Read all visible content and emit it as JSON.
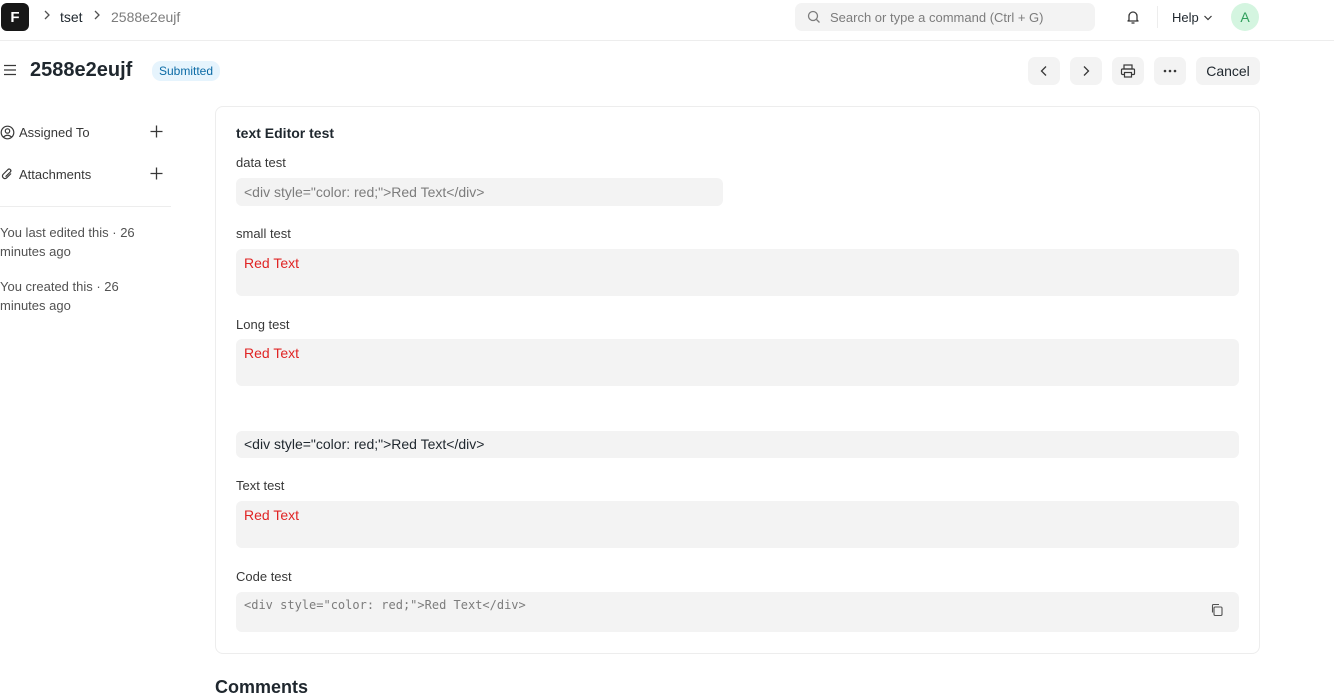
{
  "navbar": {
    "logo_letter": "F",
    "breadcrumbs": [
      "tset",
      "2588e2eujf"
    ],
    "search_placeholder": "Search or type a command (Ctrl + G)",
    "help_label": "Help",
    "avatar_initial": "A"
  },
  "header": {
    "title": "2588e2eujf",
    "status": "Submitted",
    "cancel_label": "Cancel"
  },
  "sidebar": {
    "assigned_label": "Assigned To",
    "attachments_label": "Attachments",
    "last_edited": "You last edited this · 26 minutes ago",
    "created": "You created this · 26 minutes ago"
  },
  "form": {
    "section_title": "text Editor test",
    "fields": [
      {
        "label": "data test",
        "value": "<div style=\"color: red;\">Red Text</div>"
      },
      {
        "label": "small test",
        "value": "Red Text"
      },
      {
        "label": "Long test",
        "value": "Red Text"
      },
      {
        "label": "",
        "value": "<div style=\"color: red;\">Red Text</div>"
      },
      {
        "label": "Text test",
        "value": "Red Text"
      },
      {
        "label": "Code test",
        "value": "<div style=\"color: red;\">Red Text</div>"
      }
    ]
  },
  "comments_title": "Comments",
  "colors": {
    "accent_red": "#e02424",
    "badge_bg": "#e6f4fd",
    "badge_text": "#0b6aa5",
    "field_bg": "#f3f3f3"
  }
}
